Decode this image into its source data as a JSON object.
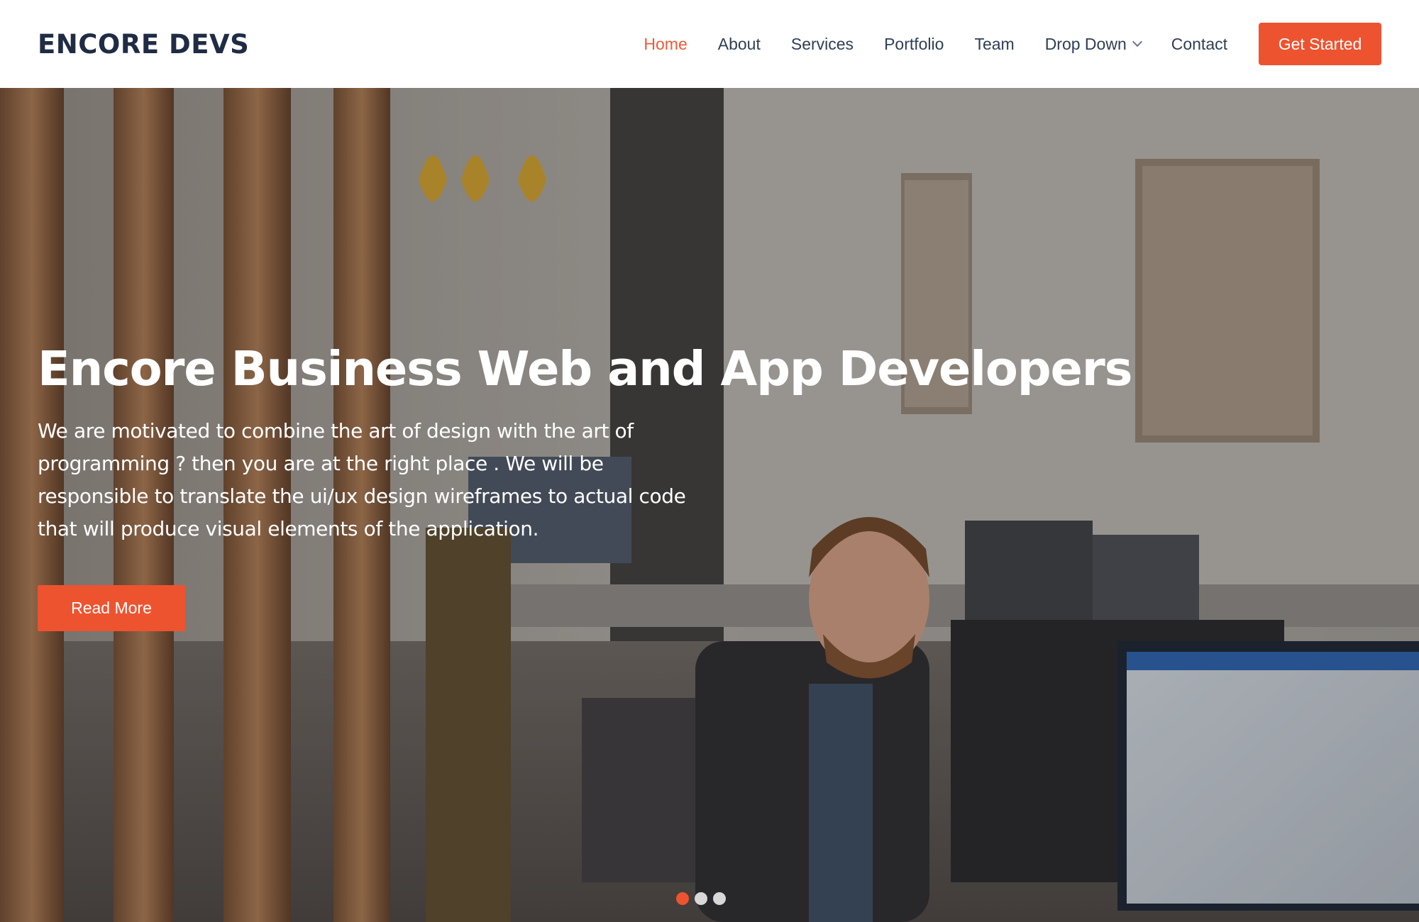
{
  "header": {
    "logo": "ENCORE DEVS",
    "nav": {
      "home": "Home",
      "about": "About",
      "services": "Services",
      "portfolio": "Portfolio",
      "team": "Team",
      "dropdown": "Drop Down",
      "contact": "Contact"
    },
    "active_item": "Home",
    "cta": "Get Started"
  },
  "hero": {
    "title": "Encore Business Web and App Developers",
    "text": "We are motivated to combine the art of design with the art of programming ? then you are at the right place . We will be responsible to translate the ui/ux design wireframes to actual code that will produce visual elements of the application.",
    "button": "Read More",
    "slides": 3,
    "active_slide": 1
  },
  "colors": {
    "accent": "#ee5330",
    "nav_text": "#2f3e55",
    "logo": "#1f2c44"
  },
  "icons": {
    "dropdown": "chevron-down-icon"
  }
}
